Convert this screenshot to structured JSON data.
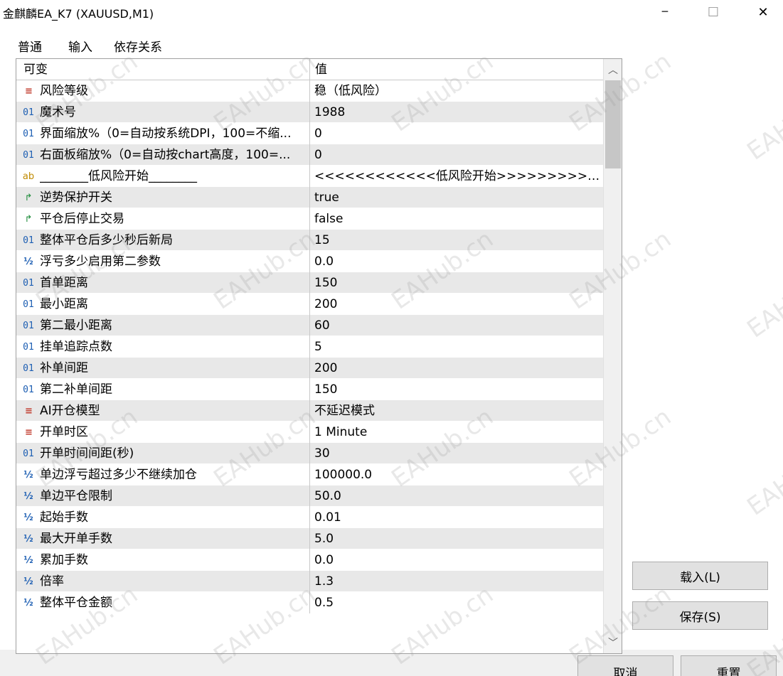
{
  "window": {
    "title": "金麒麟EA_K7 (XAUUSD,M1)",
    "minimize_glyph": "─",
    "maximize_glyph": "☐",
    "close_glyph": "✕"
  },
  "tabs": [
    {
      "label": "普通"
    },
    {
      "label": "输入"
    },
    {
      "label": "依存关系"
    }
  ],
  "active_tab": "输入",
  "grid": {
    "header_variable": "可变",
    "header_value": "值",
    "rows": [
      {
        "type": "enum",
        "icon_text": "≡",
        "name": "风险等级",
        "value": "稳（低风险）"
      },
      {
        "type": "int",
        "icon_text": "01",
        "name": "魔术号",
        "value": "1988"
      },
      {
        "type": "int",
        "icon_text": "01",
        "name": "界面缩放%（0=自动按系统DPI，100=不缩...",
        "value": "0"
      },
      {
        "type": "int",
        "icon_text": "01",
        "name": "右面板缩放%（0=自动按chart高度，100=...",
        "value": "0"
      },
      {
        "type": "string",
        "icon_text": "ab",
        "name": "________低风险开始________",
        "value": "<<<<<<<<<<<<低风险开始>>>>>>>>>>>>..."
      },
      {
        "type": "bool",
        "icon_text": "↱",
        "name": "逆势保护开关",
        "value": "true"
      },
      {
        "type": "bool",
        "icon_text": "↱",
        "name": "平仓后停止交易",
        "value": "false"
      },
      {
        "type": "int",
        "icon_text": "01",
        "name": "整体平仓后多少秒后新局",
        "value": "15"
      },
      {
        "type": "double",
        "icon_text": "½",
        "name": "浮亏多少启用第二参数",
        "value": "0.0"
      },
      {
        "type": "int",
        "icon_text": "01",
        "name": "首单距离",
        "value": "150"
      },
      {
        "type": "int",
        "icon_text": "01",
        "name": "最小距离",
        "value": "200"
      },
      {
        "type": "int",
        "icon_text": "01",
        "name": "第二最小距离",
        "value": "60"
      },
      {
        "type": "int",
        "icon_text": "01",
        "name": "挂单追踪点数",
        "value": "5"
      },
      {
        "type": "int",
        "icon_text": "01",
        "name": "补单间距",
        "value": "200"
      },
      {
        "type": "int",
        "icon_text": "01",
        "name": "第二补单间距",
        "value": "150"
      },
      {
        "type": "enum",
        "icon_text": "≡",
        "name": "AI开仓模型",
        "value": "不延迟模式"
      },
      {
        "type": "enum",
        "icon_text": "≡",
        "name": "开单时区",
        "value": "1 Minute"
      },
      {
        "type": "int",
        "icon_text": "01",
        "name": "开单时间间距(秒)",
        "value": "30"
      },
      {
        "type": "double",
        "icon_text": "½",
        "name": "单边浮亏超过多少不继续加仓",
        "value": "100000.0"
      },
      {
        "type": "double",
        "icon_text": "½",
        "name": "单边平仓限制",
        "value": "50.0"
      },
      {
        "type": "double",
        "icon_text": "½",
        "name": "起始手数",
        "value": "0.01"
      },
      {
        "type": "double",
        "icon_text": "½",
        "name": "最大开单手数",
        "value": "5.0"
      },
      {
        "type": "double",
        "icon_text": "½",
        "name": "累加手数",
        "value": "0.0"
      },
      {
        "type": "double",
        "icon_text": "½",
        "name": "倍率",
        "value": "1.3"
      },
      {
        "type": "double",
        "icon_text": "½",
        "name": "整体平仓金额",
        "value": "0.5"
      }
    ]
  },
  "scrollbar": {
    "up_glyph": "︿",
    "down_glyph": "﹀"
  },
  "buttons": {
    "load": "载入(L)",
    "save": "保存(S)",
    "cancel": "取消",
    "reset": "重置"
  },
  "watermark_text": "EAHub.cn"
}
